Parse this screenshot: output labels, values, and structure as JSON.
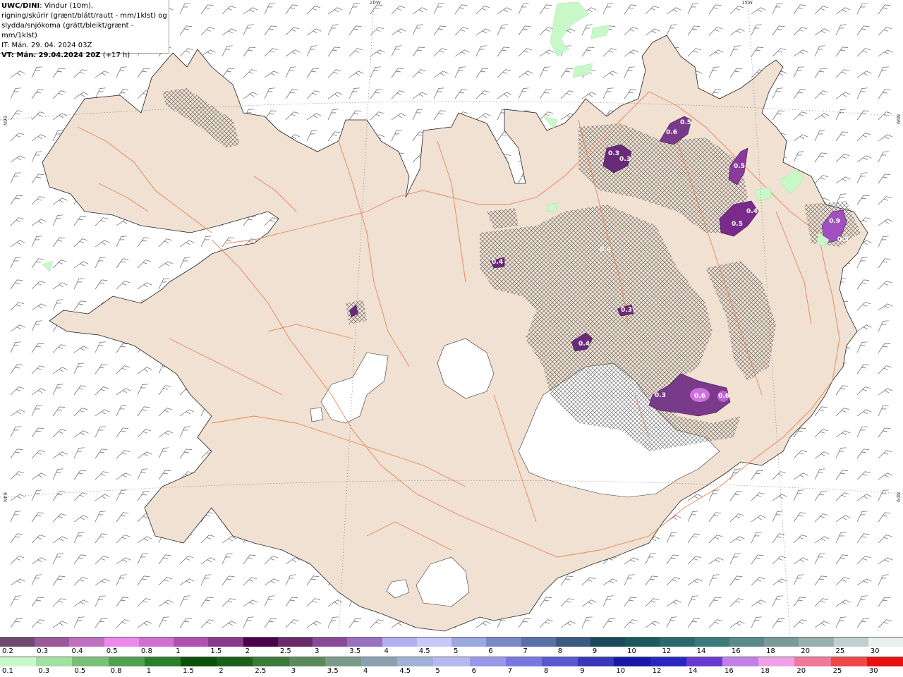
{
  "info": {
    "title": "UWC/DINI",
    "line1_rest": ": Vindur (10m),",
    "line2": "rigning/skúrir (grænt/blátt/rautt - mm/1klst) og",
    "line3": "slydda/snjókoma (grátt/bleikt/grænt - mm/1klst)",
    "it": "IT: Mán. 29. 04. 2024 03Z",
    "vt_bold": "VT: Mán. 29.04.2024 20Z",
    "vt_rest": " (+17 h)"
  },
  "graticule": {
    "top_20w": "20W",
    "top_15w": "15W",
    "left_66n": "66N",
    "left_64n": "64N",
    "right_66n": "66N",
    "right_64n": "64N"
  },
  "precip_labels": [
    "0.6",
    "0.5",
    "0.3",
    "0.3",
    "0.5",
    "0.4",
    "0.5",
    "0.9",
    "0.3",
    "0.4",
    "0.4",
    "0.3",
    "0.4",
    "0.3",
    "0.6",
    "0.6"
  ],
  "legend_snow": {
    "labels": [
      "0.2",
      "0.3",
      "0.4",
      "0.5",
      "0.8",
      "1",
      "1.5",
      "2",
      "2.5",
      "3",
      "3.5",
      "4",
      "4.5",
      "5",
      "6",
      "7",
      "8",
      "9",
      "10",
      "12",
      "14",
      "16",
      "18",
      "20",
      "25",
      "30"
    ],
    "colors": [
      "#6e4a6e",
      "#9a5a9a",
      "#c070c0",
      "#ee88ee",
      "#d070d0",
      "#b050b0",
      "#8a3a8a",
      "#4a004a",
      "#6a2a6a",
      "#8a4a9a",
      "#9a70c0",
      "#b0b0ee",
      "#c8c8f8",
      "#9aa8e0",
      "#7a88c8",
      "#5a70a8",
      "#3a5a80",
      "#1a4a5a",
      "#1a5a5a",
      "#2a6a6a",
      "#3a7a7a",
      "#5a8a8a",
      "#7a9a9a",
      "#9ab0b0",
      "#c0d0d0",
      "#e8f0f0"
    ]
  },
  "legend_rain": {
    "labels": [
      "0.1",
      "0.3",
      "0.5",
      "0.8",
      "1",
      "1.5",
      "2",
      "2.5",
      "3",
      "3.5",
      "4",
      "4.5",
      "5",
      "6",
      "7",
      "8",
      "9",
      "10",
      "12",
      "14",
      "16",
      "18",
      "20",
      "25",
      "30"
    ],
    "colors": [
      "#c8f8c8",
      "#a0e0a0",
      "#78c078",
      "#50a050",
      "#2a802a",
      "#0a500a",
      "#1a601a",
      "#3a7a3a",
      "#5a8a5a",
      "#7a9a8a",
      "#8aa0b0",
      "#a0b0d8",
      "#b8b8f0",
      "#9898e8",
      "#7878e0",
      "#5858d0",
      "#3838b8",
      "#1818a8",
      "#2828c0",
      "#6a3ad0",
      "#c080e8",
      "#f0a0e8",
      "#f07898",
      "#f04848",
      "#e81010"
    ]
  }
}
